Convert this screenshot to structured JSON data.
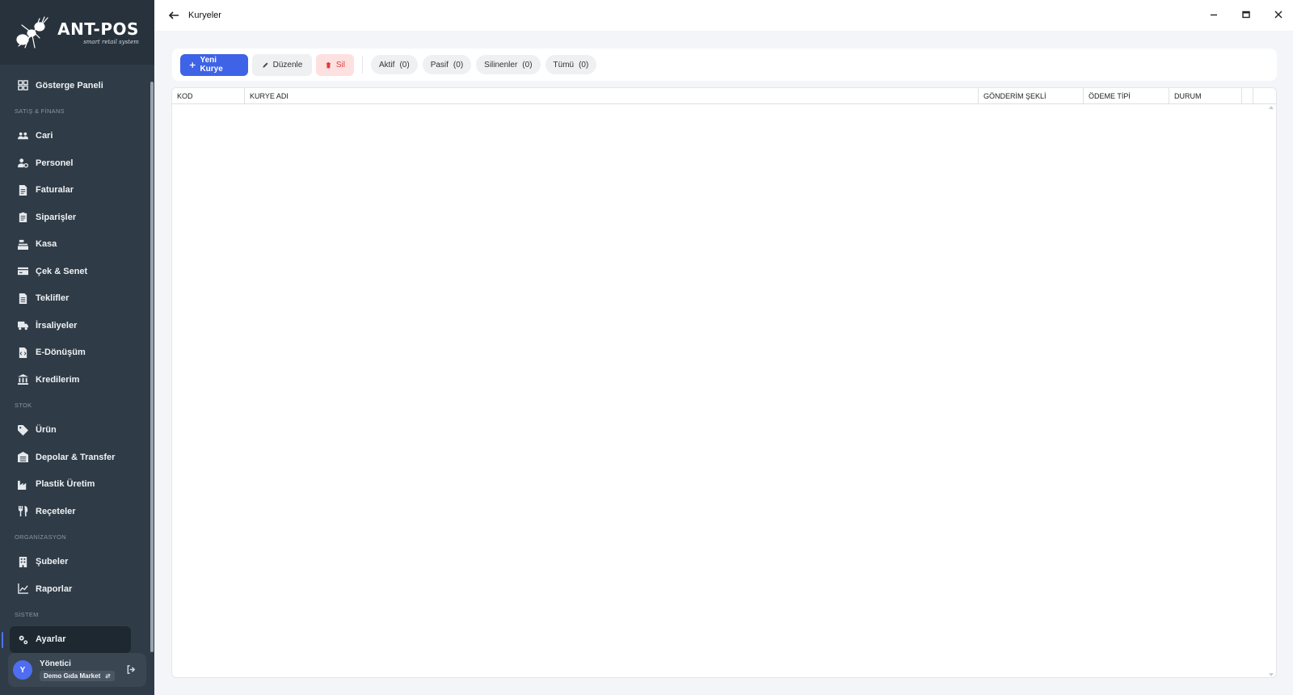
{
  "app": {
    "logo_title": "ANT-POS",
    "logo_subtitle": "smart retail system"
  },
  "colors": {
    "sidebar_bg": "#2f3b46",
    "accent": "#3e63e6",
    "danger": "#e23b3b"
  },
  "sidebar": {
    "items": [
      {
        "type": "item",
        "label": "Gösterge Paneli",
        "icon": "dashboard-icon"
      },
      {
        "type": "section",
        "label": "SATIŞ & FİNANS"
      },
      {
        "type": "item",
        "label": "Cari",
        "icon": "users-icon"
      },
      {
        "type": "item",
        "label": "Personel",
        "icon": "user-cog-icon"
      },
      {
        "type": "item",
        "label": "Faturalar",
        "icon": "invoice-icon"
      },
      {
        "type": "item",
        "label": "Siparişler",
        "icon": "clipboard-icon"
      },
      {
        "type": "item",
        "label": "Kasa",
        "icon": "cash-register-icon"
      },
      {
        "type": "item",
        "label": "Çek & Senet",
        "icon": "card-icon"
      },
      {
        "type": "item",
        "label": "Teklifler",
        "icon": "document-icon"
      },
      {
        "type": "item",
        "label": "İrsaliyeler",
        "icon": "truck-icon"
      },
      {
        "type": "item",
        "label": "E-Dönüşüm",
        "icon": "file-code-icon"
      },
      {
        "type": "item",
        "label": "Kredilerim",
        "icon": "bank-icon"
      },
      {
        "type": "section",
        "label": "STOK"
      },
      {
        "type": "item",
        "label": "Ürün",
        "icon": "tag-icon"
      },
      {
        "type": "item",
        "label": "Depolar & Transfer",
        "icon": "warehouse-icon"
      },
      {
        "type": "item",
        "label": "Plastik Üretim",
        "icon": "industry-icon"
      },
      {
        "type": "item",
        "label": "Reçeteler",
        "icon": "utensils-icon"
      },
      {
        "type": "section",
        "label": "ORGANİZASYON"
      },
      {
        "type": "item",
        "label": "Şubeler",
        "icon": "building-icon"
      },
      {
        "type": "item",
        "label": "Raporlar",
        "icon": "chart-line-icon"
      },
      {
        "type": "section",
        "label": "SİSTEM"
      },
      {
        "type": "item",
        "label": "Ayarlar",
        "icon": "gears-icon",
        "active": true
      }
    ],
    "user": {
      "avatar_letter": "Y",
      "name": "Yönetici",
      "company": "Demo Gıda Market"
    }
  },
  "titlebar": {
    "title": "Kuryeler"
  },
  "toolbar": {
    "new_label": "Yeni Kurye",
    "edit_label": "Düzenle",
    "delete_label": "Sil",
    "filters": [
      {
        "label": "Aktif",
        "count": "(0)"
      },
      {
        "label": "Pasif",
        "count": "(0)"
      },
      {
        "label": "Silinenler",
        "count": "(0)"
      },
      {
        "label": "Tümü",
        "count": "(0)"
      }
    ]
  },
  "table": {
    "columns": [
      "KOD",
      "KURYE ADI",
      "GÖNDERİM ŞEKLİ",
      "ÖDEME TİPİ",
      "DURUM"
    ],
    "rows": []
  }
}
